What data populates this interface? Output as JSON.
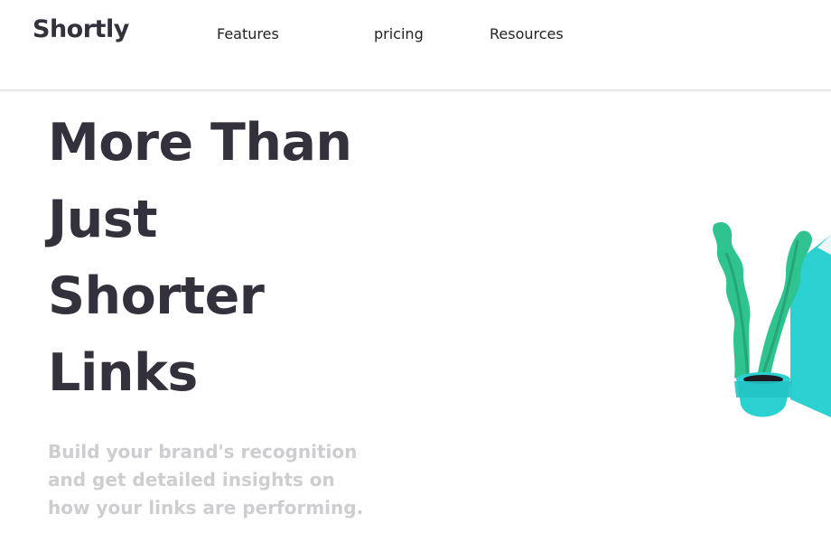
{
  "brand": {
    "logo_text": "Shortly"
  },
  "nav": {
    "items": [
      {
        "label": "Features"
      },
      {
        "label": "pricing"
      },
      {
        "label": "Resources"
      }
    ]
  },
  "hero": {
    "title_lines": [
      "More Than",
      "Just",
      "Shorter",
      "Links"
    ],
    "description": "Build your brand's recognition and get detailed insights on how your links are performing."
  },
  "colors": {
    "heading": "#34313d",
    "muted_text": "#cdcdd2",
    "plant_green": "#2fc38f",
    "pot_cyan": "#2bd0d0"
  },
  "icons": {
    "illustration": "working-person-plant-illustration"
  }
}
